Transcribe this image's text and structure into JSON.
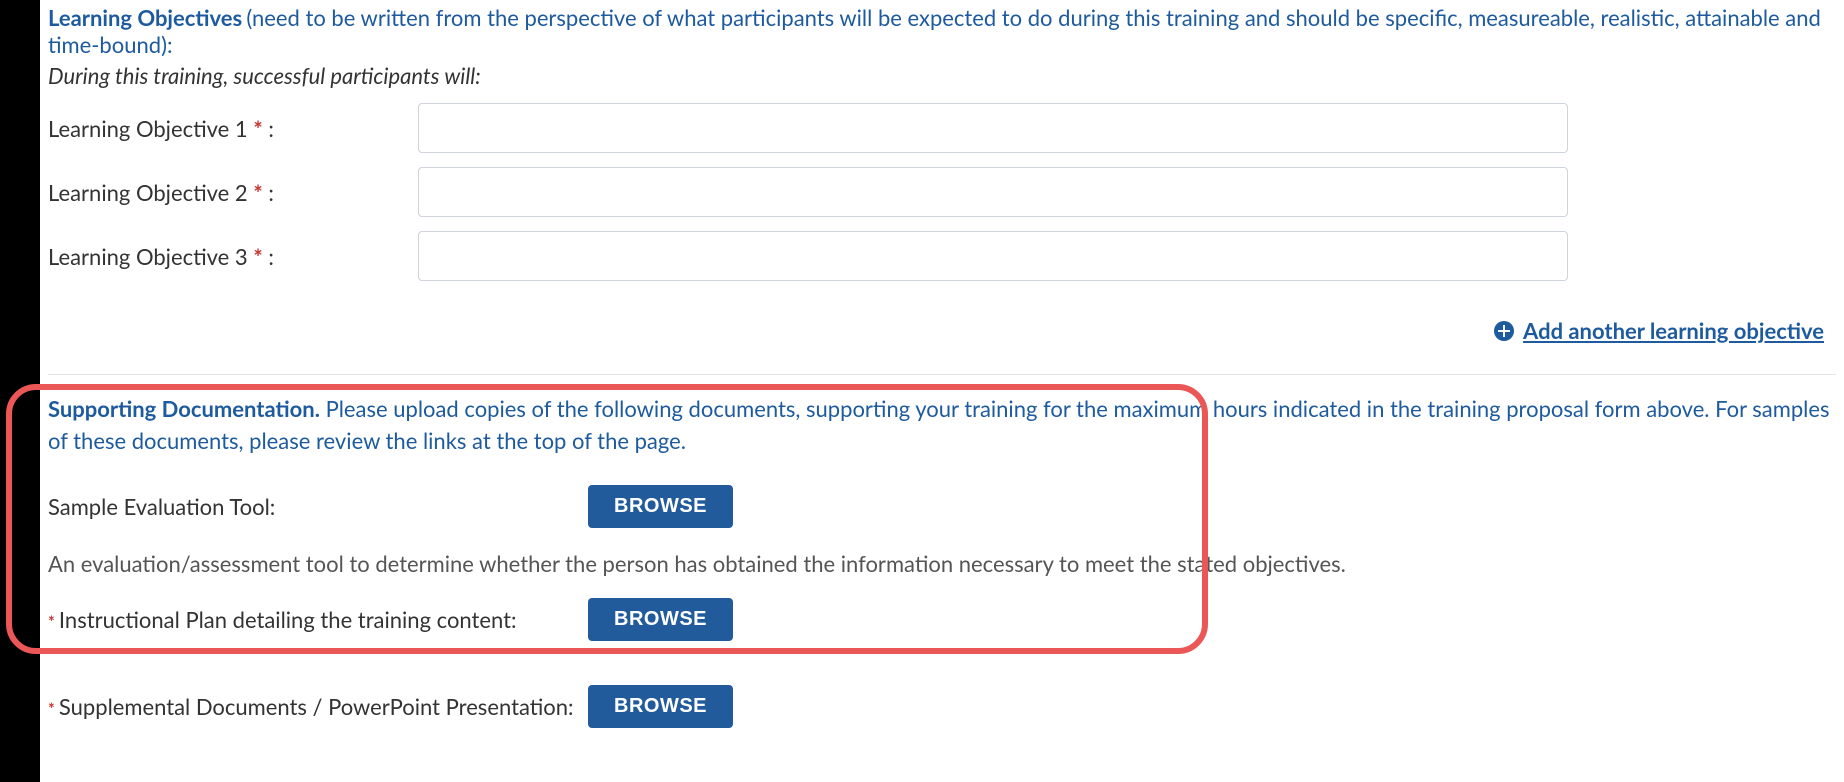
{
  "learning": {
    "title": "Learning Objectives",
    "desc": "(need to be written from the perspective of what participants will be expected to do during this training and should be specific, measureable, realistic, attainable and time-bound):",
    "note": "During this training, successful participants will:",
    "fields": [
      {
        "label": "Learning Objective 1",
        "suffix": ":",
        "value": ""
      },
      {
        "label": "Learning Objective 2",
        "suffix": ":",
        "value": ""
      },
      {
        "label": "Learning Objective 3",
        "suffix": ":",
        "value": ""
      }
    ],
    "add_link": "Add another learning objective"
  },
  "supporting": {
    "title": "Supporting Documentation.",
    "desc": "Please upload copies of the following documents, supporting your training for the maximum hours indicated in the training proposal form above. For samples of these documents, please review the links at the top of the page.",
    "rows": [
      {
        "label": "Sample Evaluation Tool:",
        "required": false,
        "button": "BROWSE"
      },
      {
        "label": "Instructional Plan detailing the training content:",
        "required": true,
        "button": "BROWSE"
      },
      {
        "label": "Supplemental Documents / PowerPoint Presentation:",
        "required": true,
        "button": "BROWSE"
      }
    ],
    "helper": "An evaluation/assessment tool to determine whether the person has obtained the information necessary to meet the stated objectives."
  },
  "required_marker": "*"
}
